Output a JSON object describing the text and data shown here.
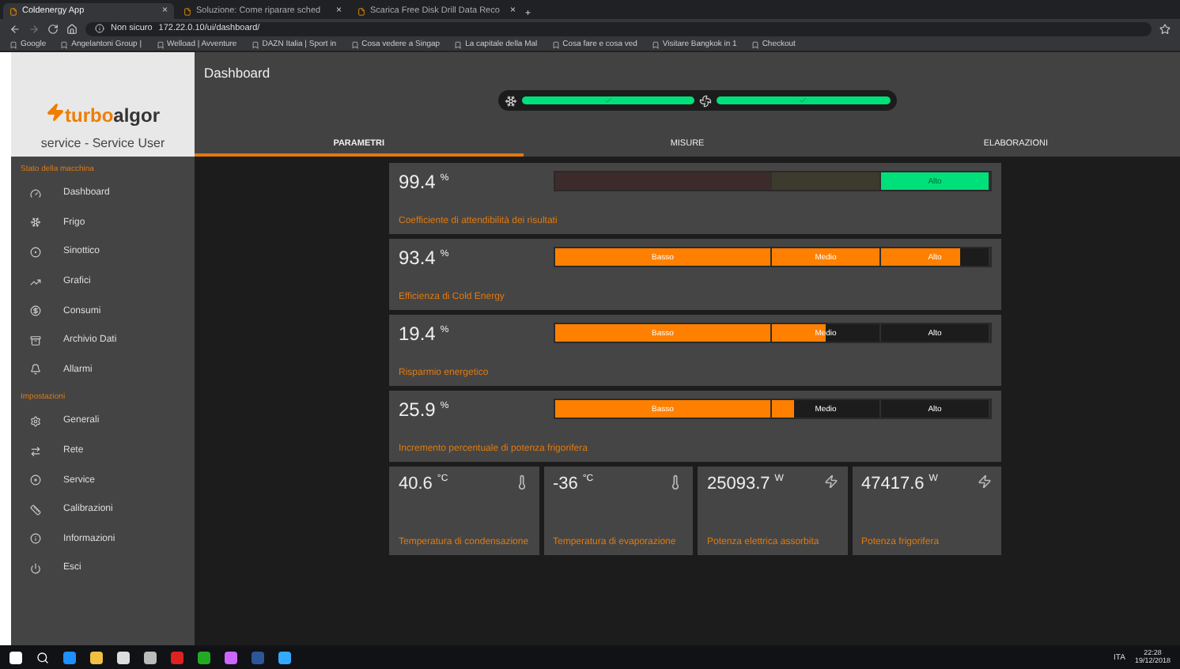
{
  "browser": {
    "tabs": [
      {
        "title": "Coldenergy App",
        "selected": true
      },
      {
        "title": "Soluzione: Come riparare sched",
        "selected": false
      },
      {
        "title": "Scarica Free Disk Drill Data Reco",
        "selected": false
      }
    ],
    "tab_close": "×",
    "new_tab": "+",
    "security": "Non sicuro",
    "url": "172.22.0.10/ui/dashboard/",
    "bookmarks": [
      "Google",
      "Angelantoni Group |",
      "Welload | Avventure",
      "DAZN Italia | Sport in",
      "Cosa vedere a Singap",
      "La capitale della Mal",
      "Cosa fare e cosa ved",
      "Visitare Bangkok in 1",
      "Checkout"
    ]
  },
  "app": {
    "logo": {
      "part_1": "turbo",
      "part_2": "algor"
    },
    "user": "service - Service User",
    "page_title": "Dashboard",
    "sidebar": [
      {
        "heading": "Stato della macchina",
        "items": [
          "Dashboard",
          "Frigo",
          "Sinottico",
          "Grafici",
          "Consumi",
          "Archivio Dati",
          "Allarmi"
        ]
      },
      {
        "heading": "Impostazioni",
        "items": [
          "Generali",
          "Rete",
          "Service",
          "Calibrazioni",
          "Informazioni",
          "Esci"
        ]
      }
    ],
    "status_indicators": [
      {
        "ok": true
      },
      {
        "ok": true
      }
    ],
    "tabs": [
      {
        "label": "PARAMETRI",
        "selected": true
      },
      {
        "label": "MISURE",
        "selected": false
      },
      {
        "label": "ELABORAZIONI",
        "selected": false
      }
    ],
    "gauges": [
      {
        "value": "99.4",
        "unit": "%",
        "label": "Coefficiente di attendibilità dei risultati",
        "kind": "zone",
        "segments": [
          {
            "active": false
          },
          {
            "active": false
          },
          {
            "label": "Alto",
            "active": true
          }
        ]
      },
      {
        "value": "93.4",
        "unit": "%",
        "label": "Efficienza di Cold Energy",
        "kind": "fill",
        "level": 0.93,
        "segments": [
          {
            "label": "Basso"
          },
          {
            "label": "Medio"
          },
          {
            "label": "Alto"
          }
        ]
      },
      {
        "value": "19.4",
        "unit": "%",
        "label": "Risparmio energetico",
        "kind": "fill",
        "level": 0.62,
        "segments": [
          {
            "label": "Basso"
          },
          {
            "label": "Medio"
          },
          {
            "label": "Alto"
          }
        ]
      },
      {
        "value": "25.9",
        "unit": "%",
        "label": "Incremento percentuale di potenza frigorifera",
        "kind": "fill",
        "level": 0.55,
        "segments": [
          {
            "label": "Basso"
          },
          {
            "label": "Medio"
          },
          {
            "label": "Alto"
          }
        ]
      }
    ],
    "metrics": [
      {
        "value": "40.6",
        "unit": "°C",
        "label": "Temperatura di condensazione",
        "kind": "temperature"
      },
      {
        "value": "-36",
        "unit": "°C",
        "label": "Temperatura di evaporazione",
        "kind": "temperature"
      },
      {
        "value": "25093.7",
        "unit": "W",
        "label": "Potenza elettrica assorbita",
        "kind": "power"
      },
      {
        "value": "47417.6",
        "unit": "W",
        "label": "Potenza frigorifera",
        "kind": "power"
      }
    ]
  },
  "taskbar": {
    "language": "ITA",
    "time": "22:28",
    "date": "19/12/2018"
  }
}
